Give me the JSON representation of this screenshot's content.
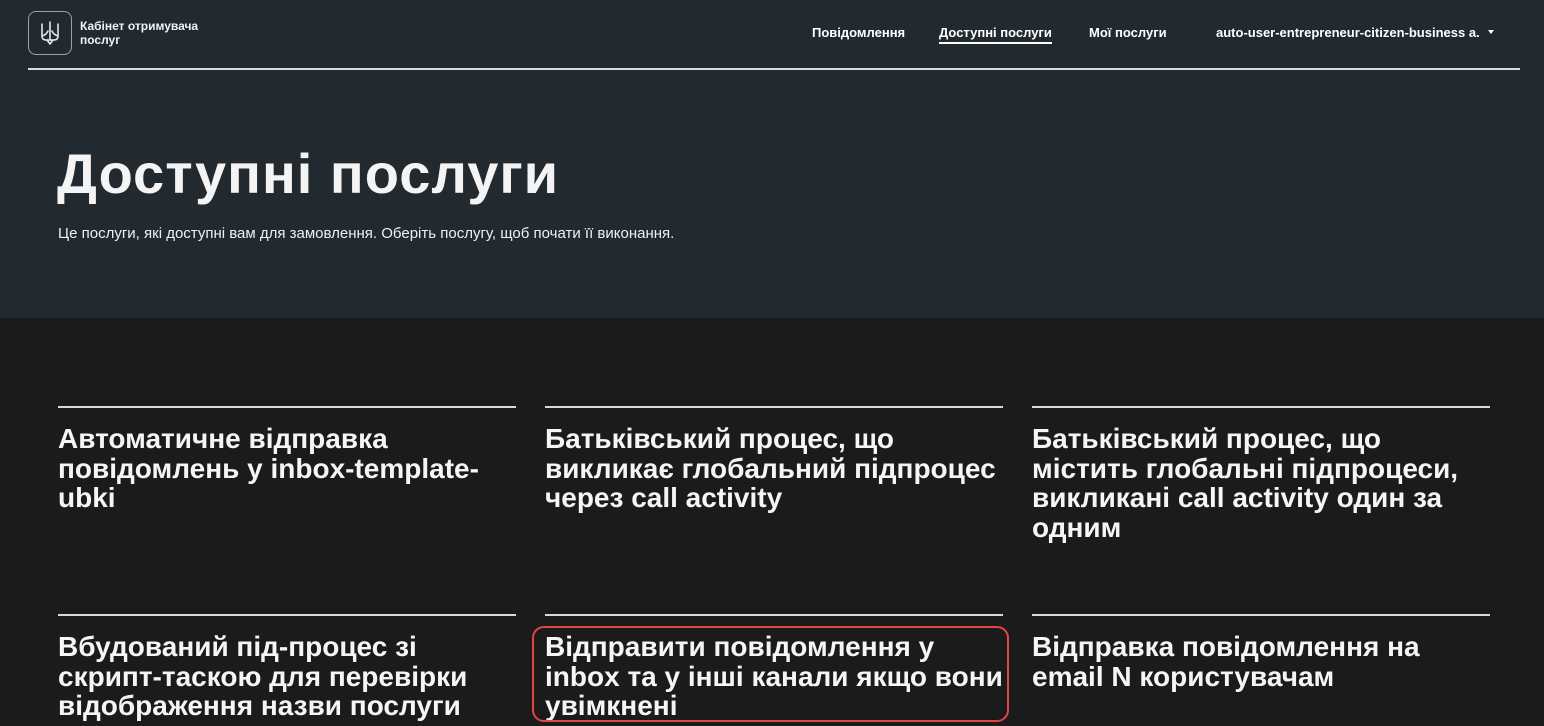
{
  "header": {
    "brand": "Кабінет отримувача послуг",
    "nav": [
      {
        "label": "Повідомлення",
        "active": false
      },
      {
        "label": "Доступні послуги",
        "active": true
      },
      {
        "label": "Мої послуги",
        "active": false
      }
    ],
    "user": "auto-user-entrepreneur-citizen-business a."
  },
  "page": {
    "title": "Доступні послуги",
    "subtitle": "Це послуги, які доступні вам для замовлення. Оберіть послугу, щоб почати її виконання."
  },
  "services": [
    {
      "title": "Автоматичне відправка повідомлень у inbox-template-ubki"
    },
    {
      "title": "Батьківський процес, що викликає глобальний підпроцес через call activity"
    },
    {
      "title": "Батьківський процес, що містить глобальні підпроцеси, викликані call activity один за одним"
    },
    {
      "title": "Вбудований під-процес зі скрипт-таскою для перевірки відображення назви послуги"
    },
    {
      "title": "Відправити повідомлення у inbox та у інші канали якщо вони увімкнені",
      "highlighted": true
    },
    {
      "title": "Відправка повідомлення на email N користувачам"
    }
  ],
  "colors": {
    "header_bg": "#222a30",
    "page_bg": "#1b1b1b",
    "highlight": "#e0454a"
  }
}
